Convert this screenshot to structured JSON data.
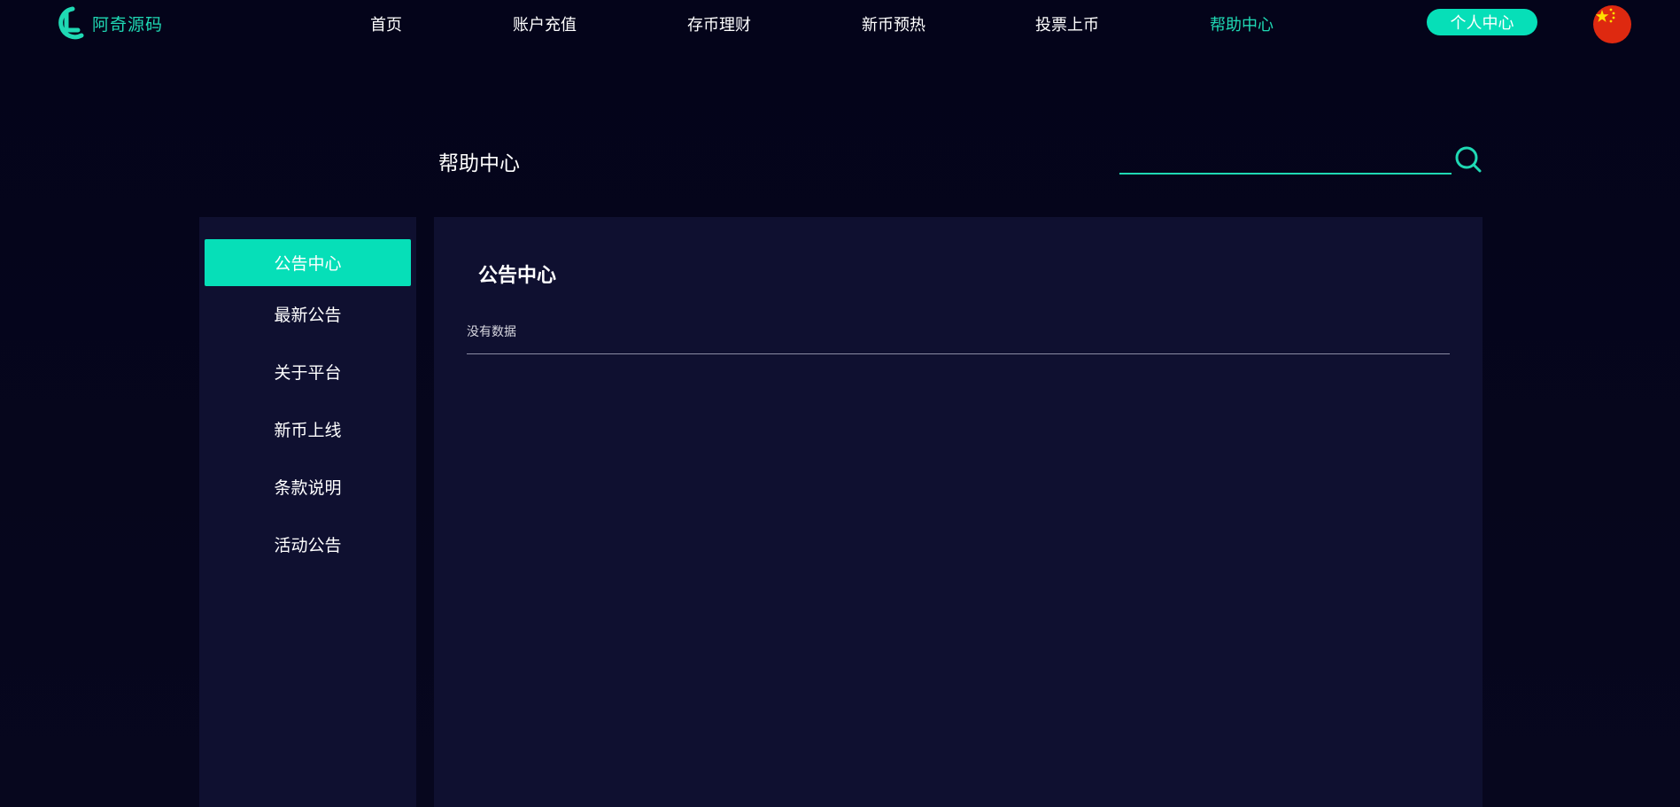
{
  "header": {
    "logo_text": "阿奇源码",
    "nav": [
      {
        "label": "首页"
      },
      {
        "label": "账户充值"
      },
      {
        "label": "存币理财"
      },
      {
        "label": "新币预热"
      },
      {
        "label": "投票上币"
      },
      {
        "label": "帮助中心",
        "active": true
      }
    ],
    "user_center_label": "个人中心",
    "language_flag": "china-flag-icon"
  },
  "help": {
    "title": "帮助中心",
    "search": {
      "value": "",
      "placeholder": ""
    }
  },
  "sidebar": {
    "items": [
      {
        "label": "公告中心",
        "active": true
      },
      {
        "label": "最新公告"
      },
      {
        "label": "关于平台"
      },
      {
        "label": "新币上线"
      },
      {
        "label": "条款说明"
      },
      {
        "label": "活动公告"
      }
    ]
  },
  "main": {
    "title": "公告中心",
    "empty_text": "没有数据"
  },
  "colors": {
    "accent": "#06dfb8",
    "accent_text": "#1fd9b4",
    "background": "#06061a",
    "panel": "#0f1030"
  }
}
